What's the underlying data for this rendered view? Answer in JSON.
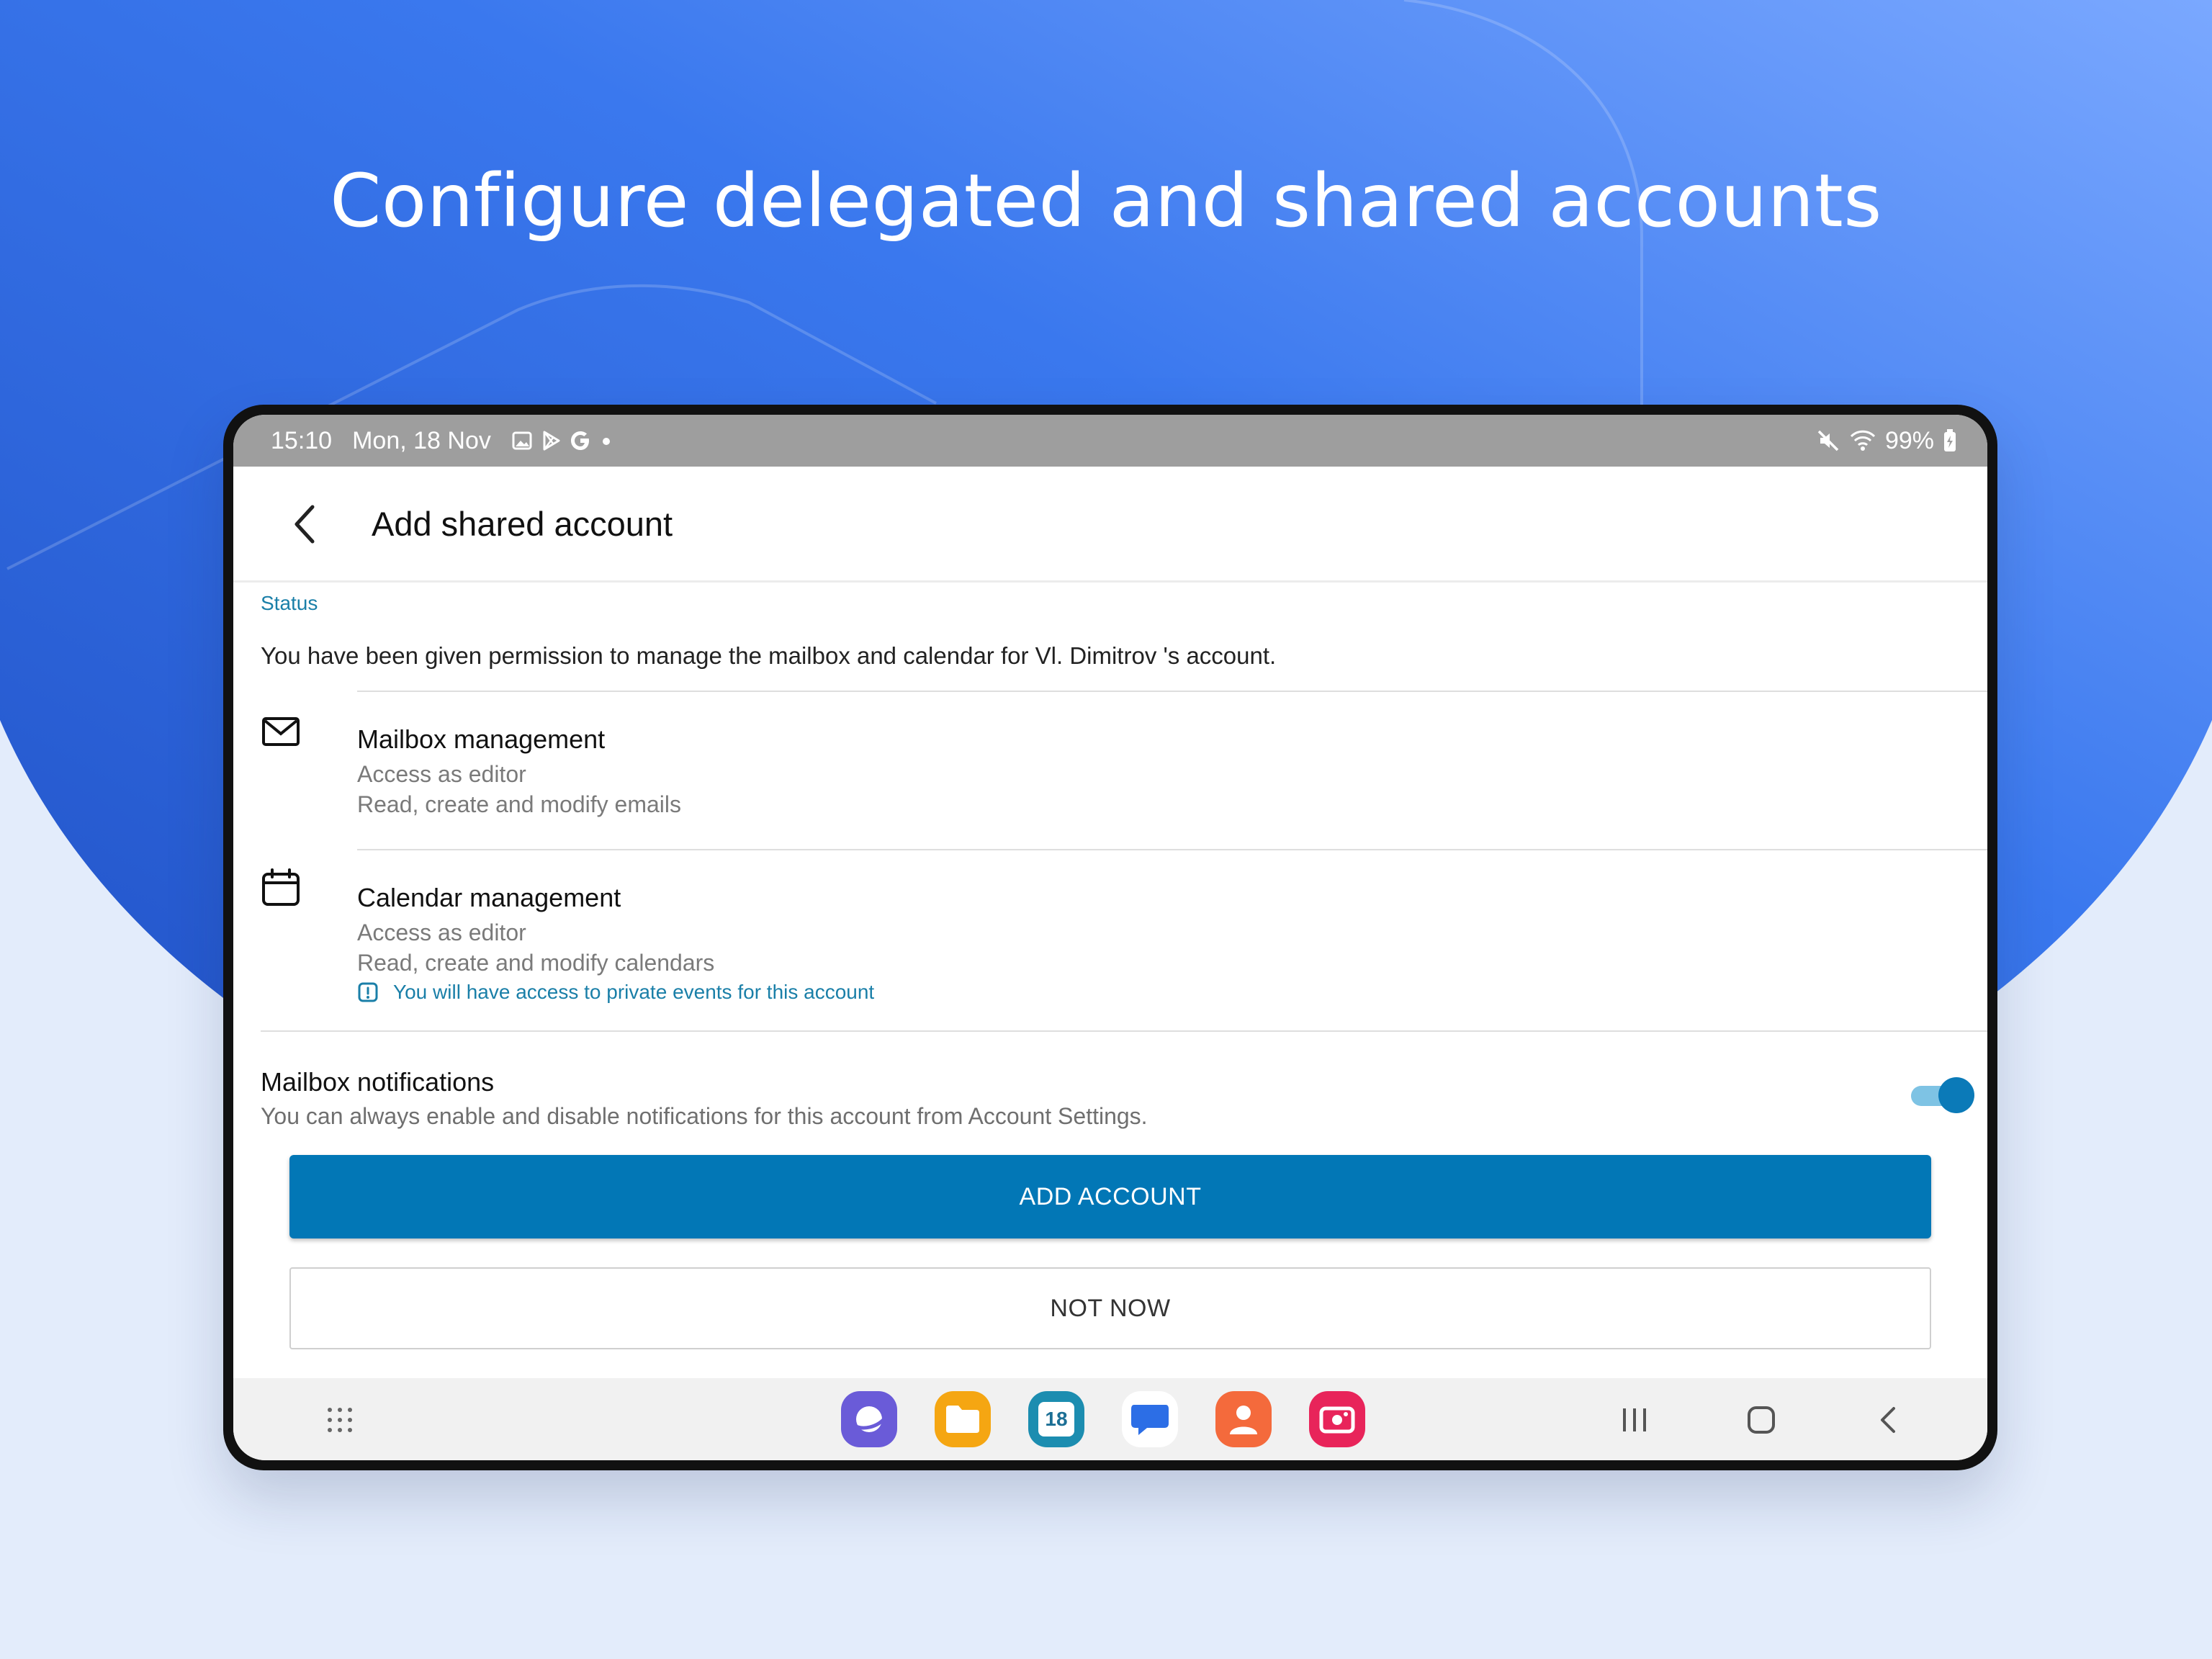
{
  "headline": "Configure delegated and shared accounts",
  "status_bar": {
    "time": "15:10",
    "date": "Mon, 18 Nov",
    "battery": "99%",
    "left_icons": [
      "gallery-icon",
      "play-store-icon",
      "google-icon",
      "more-dot-icon"
    ],
    "right_icons": [
      "mute-icon",
      "wifi-icon",
      "battery-icon"
    ]
  },
  "app_bar": {
    "title": "Add shared account"
  },
  "status_section": {
    "label": "Status",
    "text": "You have been given permission to manage the mailbox and calendar for Vl. Dimitrov 's account."
  },
  "permissions": [
    {
      "icon": "mail-icon",
      "title": "Mailbox management",
      "access": "Access as editor",
      "description": "Read, create and modify emails"
    },
    {
      "icon": "calendar-icon",
      "title": "Calendar management",
      "access": "Access as editor",
      "description": "Read, create and modify calendars",
      "note": "You will have access to private events for this account"
    }
  ],
  "notifications": {
    "title": "Mailbox notifications",
    "description": "You can always enable and disable notifications for this account from Account Settings.",
    "enabled": true
  },
  "buttons": {
    "add_account": "ADD ACCOUNT",
    "not_now": "NOT NOW"
  },
  "taskbar": {
    "dock_apps": [
      {
        "name": "internet-browser-icon",
        "color": "#6a5bd8"
      },
      {
        "name": "my-files-icon",
        "color": "#f5a612"
      },
      {
        "name": "calendar-app-icon",
        "color": "#1c8db0",
        "label": "18"
      },
      {
        "name": "messages-icon",
        "color": "#ffffff"
      },
      {
        "name": "contacts-icon",
        "color": "#f46a3c"
      },
      {
        "name": "screen-recorder-icon",
        "color": "#e8245a"
      }
    ],
    "nav": [
      "recents-icon",
      "home-icon",
      "back-icon"
    ]
  },
  "colors": {
    "accent": "#0277b6",
    "link": "#1a7fa8",
    "hero_blue": "#2f6be0",
    "page_bg": "#e3ecfb"
  }
}
